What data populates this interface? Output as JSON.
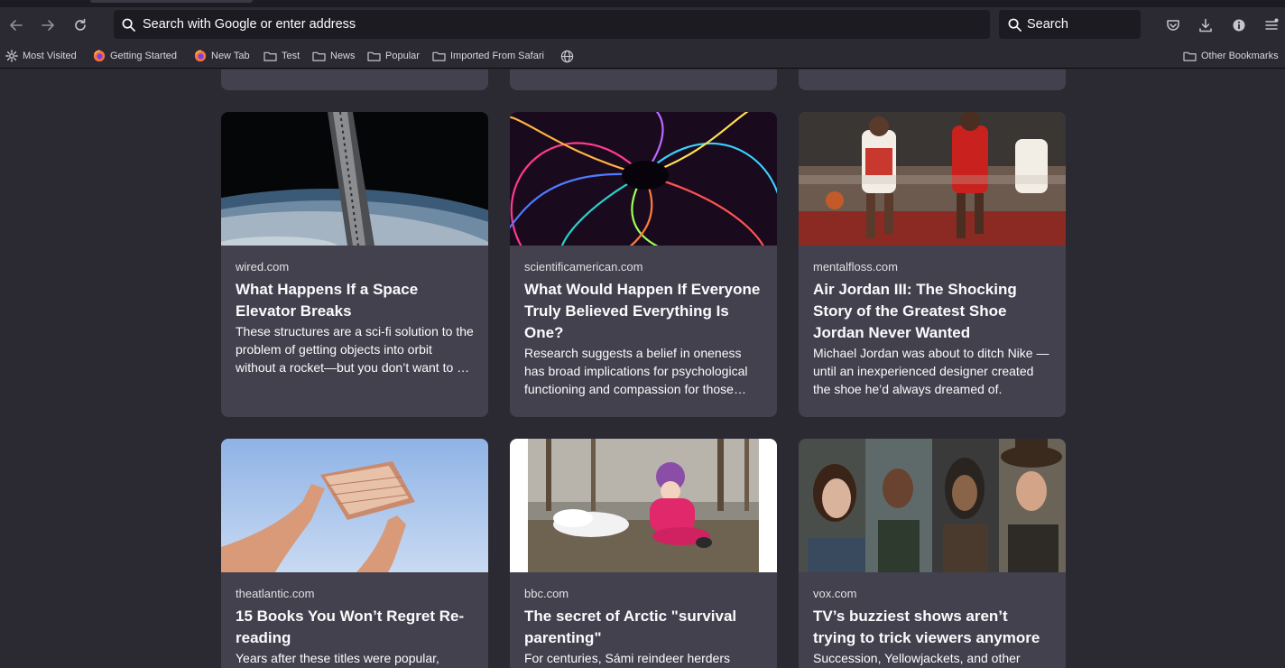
{
  "toolbar": {
    "url_placeholder": "Search with Google or enter address",
    "search_label": "Search"
  },
  "bookmarks": [
    {
      "label": "Most Visited",
      "icon": "gear-icon"
    },
    {
      "label": "Getting Started",
      "icon": "firefox-icon"
    },
    {
      "label": "New Tab",
      "icon": "firefox-icon"
    },
    {
      "label": "Test",
      "icon": "folder-icon"
    },
    {
      "label": "News",
      "icon": "folder-icon"
    },
    {
      "label": "Popular",
      "icon": "folder-icon"
    },
    {
      "label": "Imported From Safari",
      "icon": "folder-icon"
    },
    {
      "label": "",
      "icon": "globe-icon"
    }
  ],
  "other_bookmarks": "Other Bookmarks",
  "stories": [
    {
      "source": "wired.com",
      "title": "What Happens If a Space Elevator Breaks",
      "excerpt": "These structures are a sci-fi solution to the problem of getting objects into orbit without a rocket—but you don’t want to be around if one breaks."
    },
    {
      "source": "scientificamerican.com",
      "title": "What Would Happen If Everyone Truly Believed Everything Is One?",
      "excerpt": "Research suggests a belief in oneness has broad implications for psychological functioning and compassion for those around us."
    },
    {
      "source": "mentalfloss.com",
      "title": "Air Jordan III: The Shocking Story of the Greatest Shoe Jordan Never Wanted",
      "excerpt": "Michael Jordan was about to ditch Nike — until an inexperienced designer created the shoe he’d always dreamed of."
    },
    {
      "source": "theatlantic.com",
      "title": "15 Books You Won’t Regret Re-reading",
      "excerpt": "Years after these titles were popular,"
    },
    {
      "source": "bbc.com",
      "title": "The secret of Arctic \"survival parenting\"",
      "excerpt": "For centuries, Sámi reindeer herders"
    },
    {
      "source": "vox.com",
      "title": "TV’s buzziest shows aren’t trying to trick viewers anymore",
      "excerpt": "Succession, Yellowjackets, and other"
    }
  ]
}
